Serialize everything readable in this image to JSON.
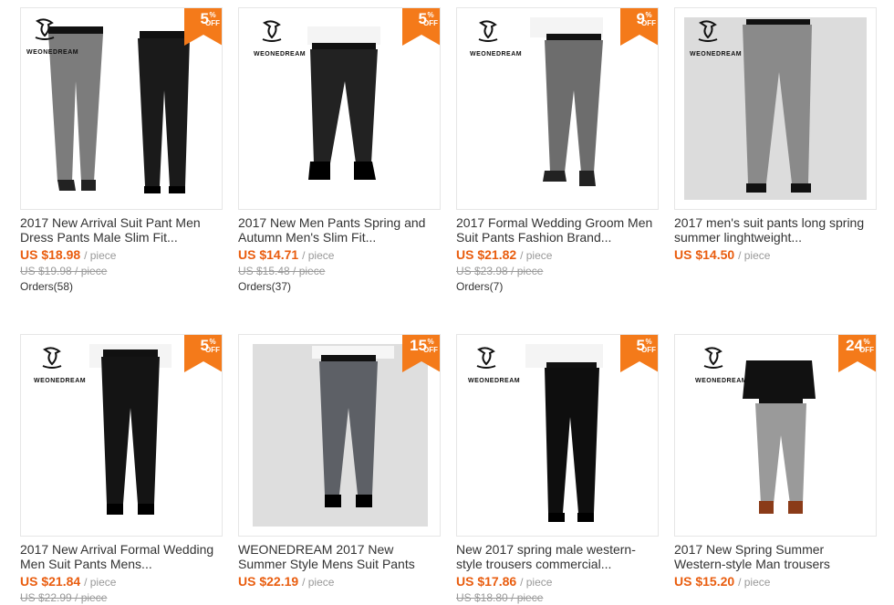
{
  "products": [
    {
      "title": "2017 New Arrival Suit Pant Men Dress Pants Male Slim Fit...",
      "price": "US $18.98",
      "unit": "/ piece",
      "original": "US $19.98 / piece",
      "orders": "Orders(58)",
      "discount": "5",
      "off": "OFF",
      "pct": "%",
      "brand": "WEONEDREAM"
    },
    {
      "title": "2017 New Men Pants Spring and Autumn Men's Slim Fit...",
      "price": "US $14.71",
      "unit": "/ piece",
      "original": "US $15.48 / piece",
      "orders": "Orders(37)",
      "discount": "5",
      "off": "OFF",
      "pct": "%",
      "brand": "WEONEDREAM"
    },
    {
      "title": "2017 Formal Wedding Groom Men Suit Pants Fashion Brand...",
      "price": "US $21.82",
      "unit": "/ piece",
      "original": "US $23.98 / piece",
      "orders": "Orders(7)",
      "discount": "9",
      "off": "OFF",
      "pct": "%",
      "brand": "WEONEDREAM"
    },
    {
      "title": "2017 men's suit pants long spring summer linghtweight...",
      "price": "US $14.50",
      "unit": "/ piece",
      "original": "",
      "orders": "",
      "discount": "",
      "off": "",
      "pct": "",
      "brand": "WEONEDREAM"
    },
    {
      "title": "2017 New Arrival Formal Wedding Men Suit Pants Mens...",
      "price": "US $21.84",
      "unit": "/ piece",
      "original": "US $22.99 / piece",
      "orders": "",
      "discount": "5",
      "off": "OFF",
      "pct": "%",
      "brand": "WEONEDREAM"
    },
    {
      "title": "WEONEDREAM 2017 New Summer Style Mens Suit Pants Men...",
      "price": "US $22.19",
      "unit": "/ piece",
      "original": "",
      "orders": "",
      "discount": "15",
      "off": "OFF",
      "pct": "%",
      "brand": ""
    },
    {
      "title": "New 2017 spring male western-style trousers commercial...",
      "price": "US $17.86",
      "unit": "/ piece",
      "original": "US $18.80 / piece",
      "orders": "",
      "discount": "5",
      "off": "OFF",
      "pct": "%",
      "brand": "WEONEDREAM"
    },
    {
      "title": "2017 New Spring Summer Western-style Man trousers Men's...",
      "price": "US $15.20",
      "unit": "/ piece",
      "original": "",
      "orders": "",
      "discount": "24",
      "off": "OFF",
      "pct": "%",
      "brand": "WEONEDREAM"
    }
  ],
  "colors": {
    "accent": "#e95d0f",
    "badge": "#f47a1a"
  }
}
